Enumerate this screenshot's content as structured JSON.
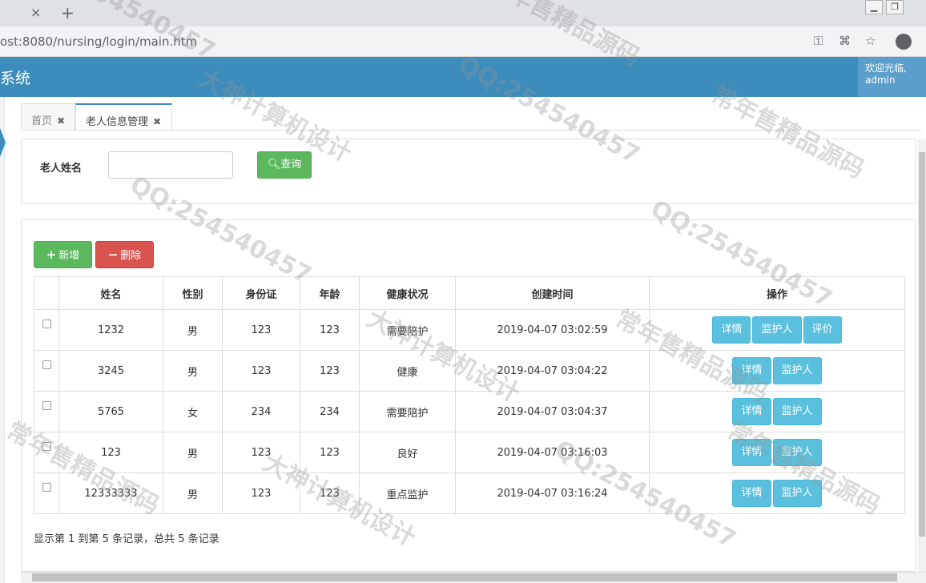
{
  "browser": {
    "url": "ost:8080/nursing/login/main.htm",
    "tab_close": "×",
    "tab_new": "+"
  },
  "header": {
    "title": "系统",
    "welcome_line1": "欢迎光临,",
    "welcome_line2": "admin"
  },
  "tabs": [
    {
      "label": "首页",
      "close": "✖"
    },
    {
      "label": "老人信息管理",
      "close": "✖"
    }
  ],
  "search": {
    "label": "老人姓名",
    "value": "",
    "button": "查询"
  },
  "toolbar": {
    "add": "新增",
    "delete": "删除"
  },
  "table": {
    "columns": [
      "姓名",
      "性别",
      "身份证",
      "年龄",
      "健康状况",
      "创建时间",
      "操作"
    ],
    "rows": [
      {
        "name": "1232",
        "gender": "男",
        "id_card": "123",
        "age": "123",
        "health": "需要陪护",
        "created": "2019-04-07 03:02:59",
        "ops": [
          "详情",
          "监护人",
          "评价"
        ]
      },
      {
        "name": "3245",
        "gender": "男",
        "id_card": "123",
        "age": "123",
        "health": "健康",
        "created": "2019-04-07 03:04:22",
        "ops": [
          "详情",
          "监护人"
        ]
      },
      {
        "name": "5765",
        "gender": "女",
        "id_card": "234",
        "age": "234",
        "health": "需要陪护",
        "created": "2019-04-07 03:04:37",
        "ops": [
          "详情",
          "监护人"
        ]
      },
      {
        "name": "123",
        "gender": "男",
        "id_card": "123",
        "age": "123",
        "health": "良好",
        "created": "2019-04-07 03:16:03",
        "ops": [
          "详情",
          "监护人"
        ]
      },
      {
        "name": "12333333",
        "gender": "男",
        "id_card": "123",
        "age": "123",
        "health": "重点监护",
        "created": "2019-04-07 03:16:24",
        "ops": [
          "详情",
          "监护人"
        ]
      }
    ]
  },
  "pager": {
    "info": "显示第 1 到第 5 条记录，总共 5 条记录"
  },
  "watermarks": [
    "QQ:254540457",
    "常年售精品源码",
    "大神计算机设计",
    "QQ:254540457",
    "常年售精品源码",
    "QQ:254540457",
    "大神计算机设计",
    "常年售精品源码",
    "QQ:254540457",
    "大神计算机设计",
    "常年售精品源码",
    "QQ:254540457",
    "常年售精品源码"
  ],
  "colors": {
    "header": "#3c8dbc",
    "success": "#5cb85c",
    "danger": "#d9534f",
    "info": "#5bc0de"
  }
}
